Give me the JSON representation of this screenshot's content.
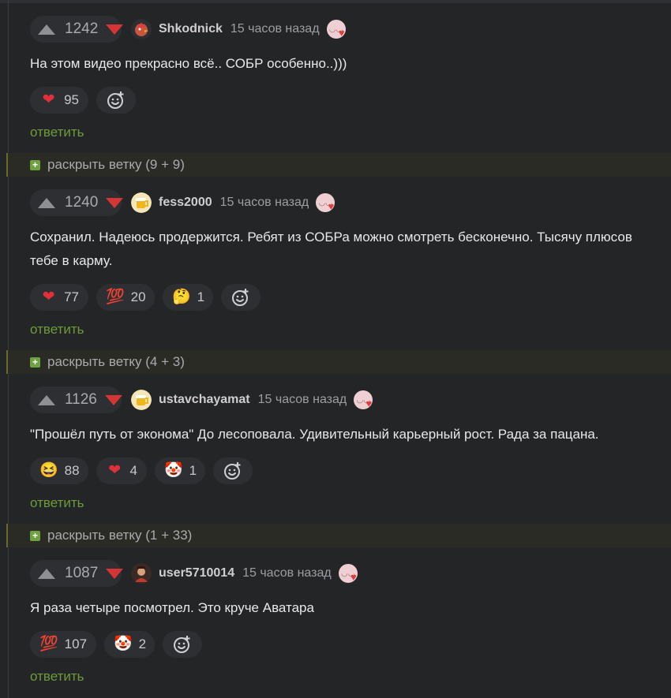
{
  "colors": {
    "background": "#242526",
    "pill": "#2e2f32",
    "downvote": "#d53535",
    "reply": "#6e9a3a",
    "expand_bg": "#2b2b26",
    "plus": "#6ea140"
  },
  "comments": [
    {
      "rating": "1242",
      "username": "Shkodnick",
      "time": "15 часов назад",
      "avatar_icon": "rooster-avatar",
      "text": "На этом видео прекрасно всё.. СОБР особенно..)))",
      "reactions": [
        {
          "icon": "heart-icon",
          "glyph": "❤",
          "count": "95"
        }
      ],
      "reply_label": "ответить"
    },
    {
      "rating": "1240",
      "username": "fess2000",
      "time": "15 часов назад",
      "avatar_icon": "beer-avatar",
      "text": "Сохранил. Надеюсь продержится. Ребят из СОБРа можно смотреть бесконечно. Тысячу плюсов тебе в карму.",
      "reactions": [
        {
          "icon": "heart-icon",
          "glyph": "❤",
          "count": "77"
        },
        {
          "icon": "hundred-icon",
          "glyph": "💯",
          "count": "20"
        },
        {
          "icon": "thinking-face-icon",
          "glyph": "🤔",
          "count": "1"
        }
      ],
      "reply_label": "ответить"
    },
    {
      "rating": "1126",
      "username": "ustavchayamat",
      "time": "15 часов назад",
      "avatar_icon": "beer-avatar",
      "text": "\"Прошёл путь от эконома\" До лесоповала. Удивительный карьерный рост. Рада за пацана.",
      "reactions": [
        {
          "icon": "laughing-face-icon",
          "glyph": "😆",
          "count": "88"
        },
        {
          "icon": "heart-icon",
          "glyph": "❤",
          "count": "4"
        },
        {
          "icon": "clown-face-icon",
          "glyph": "🤡",
          "count": "1"
        }
      ],
      "reply_label": "ответить"
    },
    {
      "rating": "1087",
      "username": "user5710014",
      "time": "15 часов назад",
      "avatar_icon": "user-avatar",
      "text": "Я раза четыре посмотрел. Это круче Аватара",
      "reactions": [
        {
          "icon": "hundred-icon",
          "glyph": "💯",
          "count": "107"
        },
        {
          "icon": "clown-face-icon",
          "glyph": "🤡",
          "count": "2"
        }
      ],
      "reply_label": "ответить"
    }
  ],
  "expand_threads": [
    {
      "label": "раскрыть ветку (9 + 9)"
    },
    {
      "label": "раскрыть ветку (4 + 3)"
    },
    {
      "label": "раскрыть ветку (1 + 33)"
    }
  ]
}
